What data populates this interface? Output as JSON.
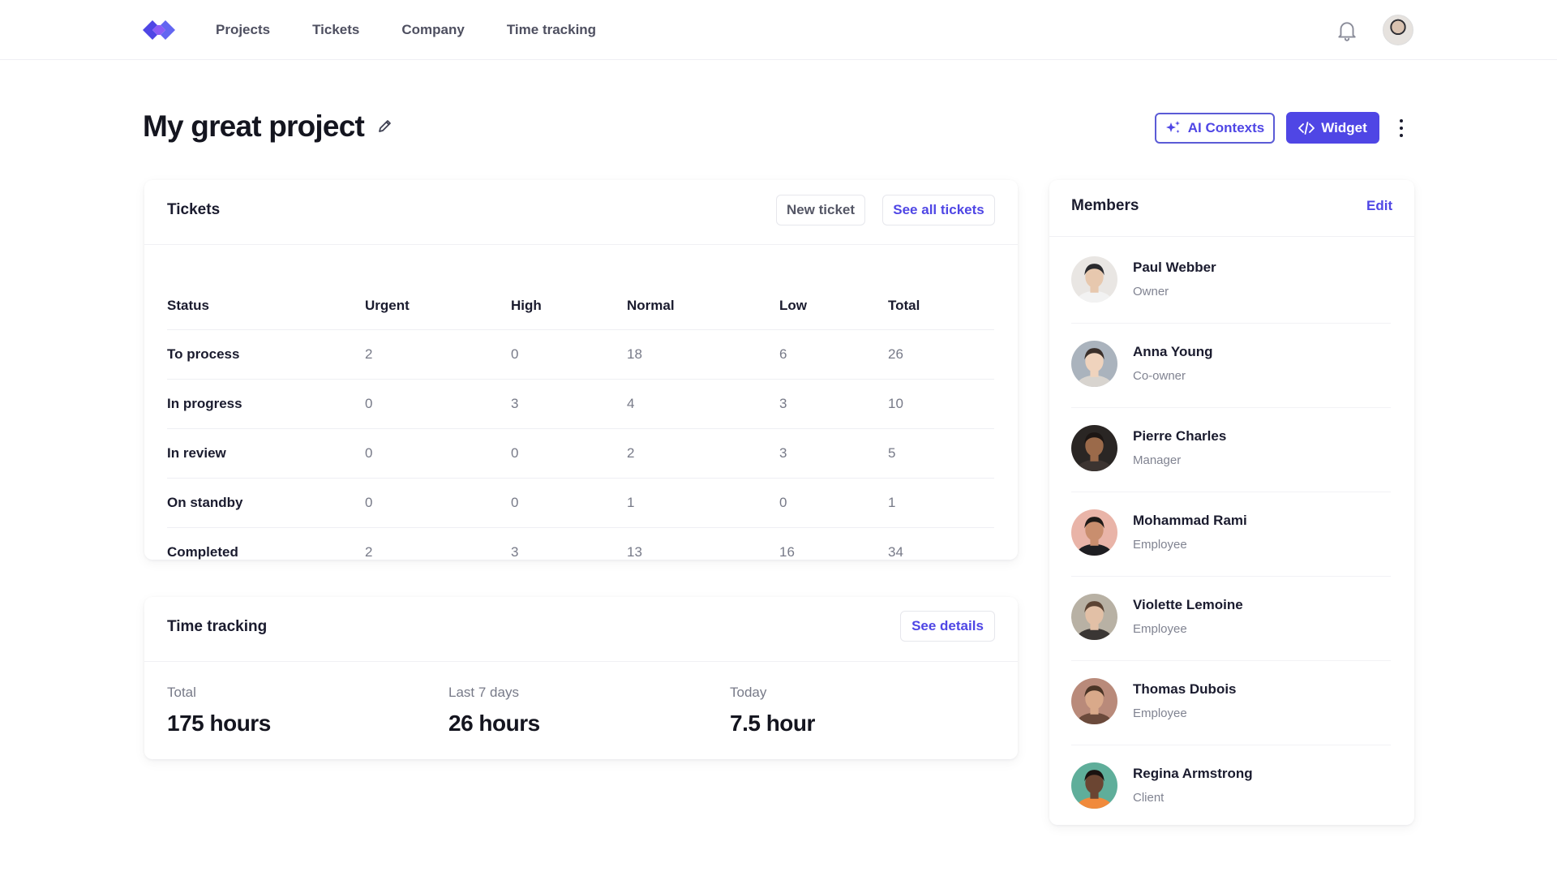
{
  "nav": {
    "items": [
      "Projects",
      "Tickets",
      "Company",
      "Time tracking"
    ],
    "logo_icon": "code-brackets-logo-icon",
    "bell_icon": "bell-icon"
  },
  "page": {
    "title": "My great project",
    "edit_icon": "pencil-icon",
    "ai_contexts_label": "AI Contexts",
    "widget_label": "Widget",
    "more_icon": "kebab-vertical-icon"
  },
  "colors": {
    "accent": "#4f46e5",
    "text": "#1a1b2e",
    "muted": "#777a88",
    "border": "#eeeff3"
  },
  "tickets": {
    "title": "Tickets",
    "new_ticket_label": "New ticket",
    "see_all_label": "See all tickets",
    "columns": [
      "Status",
      "Urgent",
      "High",
      "Normal",
      "Low",
      "Total"
    ],
    "rows": [
      {
        "status": "To process",
        "urgent": "2",
        "high": "0",
        "normal": "18",
        "low": "6",
        "total": "26"
      },
      {
        "status": "In progress",
        "urgent": "0",
        "high": "3",
        "normal": "4",
        "low": "3",
        "total": "10"
      },
      {
        "status": "In review",
        "urgent": "0",
        "high": "0",
        "normal": "2",
        "low": "3",
        "total": "5"
      },
      {
        "status": "On standby",
        "urgent": "0",
        "high": "0",
        "normal": "1",
        "low": "0",
        "total": "1"
      },
      {
        "status": "Completed",
        "urgent": "2",
        "high": "3",
        "normal": "13",
        "low": "16",
        "total": "34"
      }
    ]
  },
  "time_tracking": {
    "title": "Time tracking",
    "see_details_label": "See details",
    "stats": [
      {
        "label": "Total",
        "value": "175 hours"
      },
      {
        "label": "Last 7 days",
        "value": "26 hours"
      },
      {
        "label": "Today",
        "value": "7.5 hour"
      }
    ]
  },
  "members": {
    "title": "Members",
    "edit_label": "Edit",
    "list": [
      {
        "name": "Paul Webber",
        "role": "Owner",
        "skin": "#e7c8ae",
        "hair": "#2a2a2e",
        "bg": "#e9e6e3",
        "shirt": "#f2f2f2"
      },
      {
        "name": "Anna Young",
        "role": "Co-owner",
        "skin": "#efd3bd",
        "hair": "#3a2f2a",
        "bg": "#aab3bd",
        "shirt": "#d8d4cf"
      },
      {
        "name": "Pierre Charles",
        "role": "Manager",
        "skin": "#9b6a4a",
        "hair": "#1c1614",
        "bg": "#2a2624",
        "shirt": "#3c3431"
      },
      {
        "name": "Mohammad Rami",
        "role": "Employee",
        "skin": "#c98e6e",
        "hair": "#1f1a18",
        "bg": "#e9b4a8",
        "shirt": "#1e1e22"
      },
      {
        "name": "Violette Lemoine",
        "role": "Employee",
        "skin": "#e2c0a6",
        "hair": "#5b4333",
        "bg": "#b8b1a4",
        "shirt": "#3a3634"
      },
      {
        "name": "Thomas Dubois",
        "role": "Employee",
        "skin": "#d9a98a",
        "hair": "#4a3426",
        "bg": "#b98a7a",
        "shirt": "#6b4a3c"
      },
      {
        "name": "Regina Armstrong",
        "role": "Client",
        "skin": "#6b4532",
        "hair": "#1a1210",
        "bg": "#5fae9a",
        "shirt": "#f08a3c"
      }
    ]
  }
}
